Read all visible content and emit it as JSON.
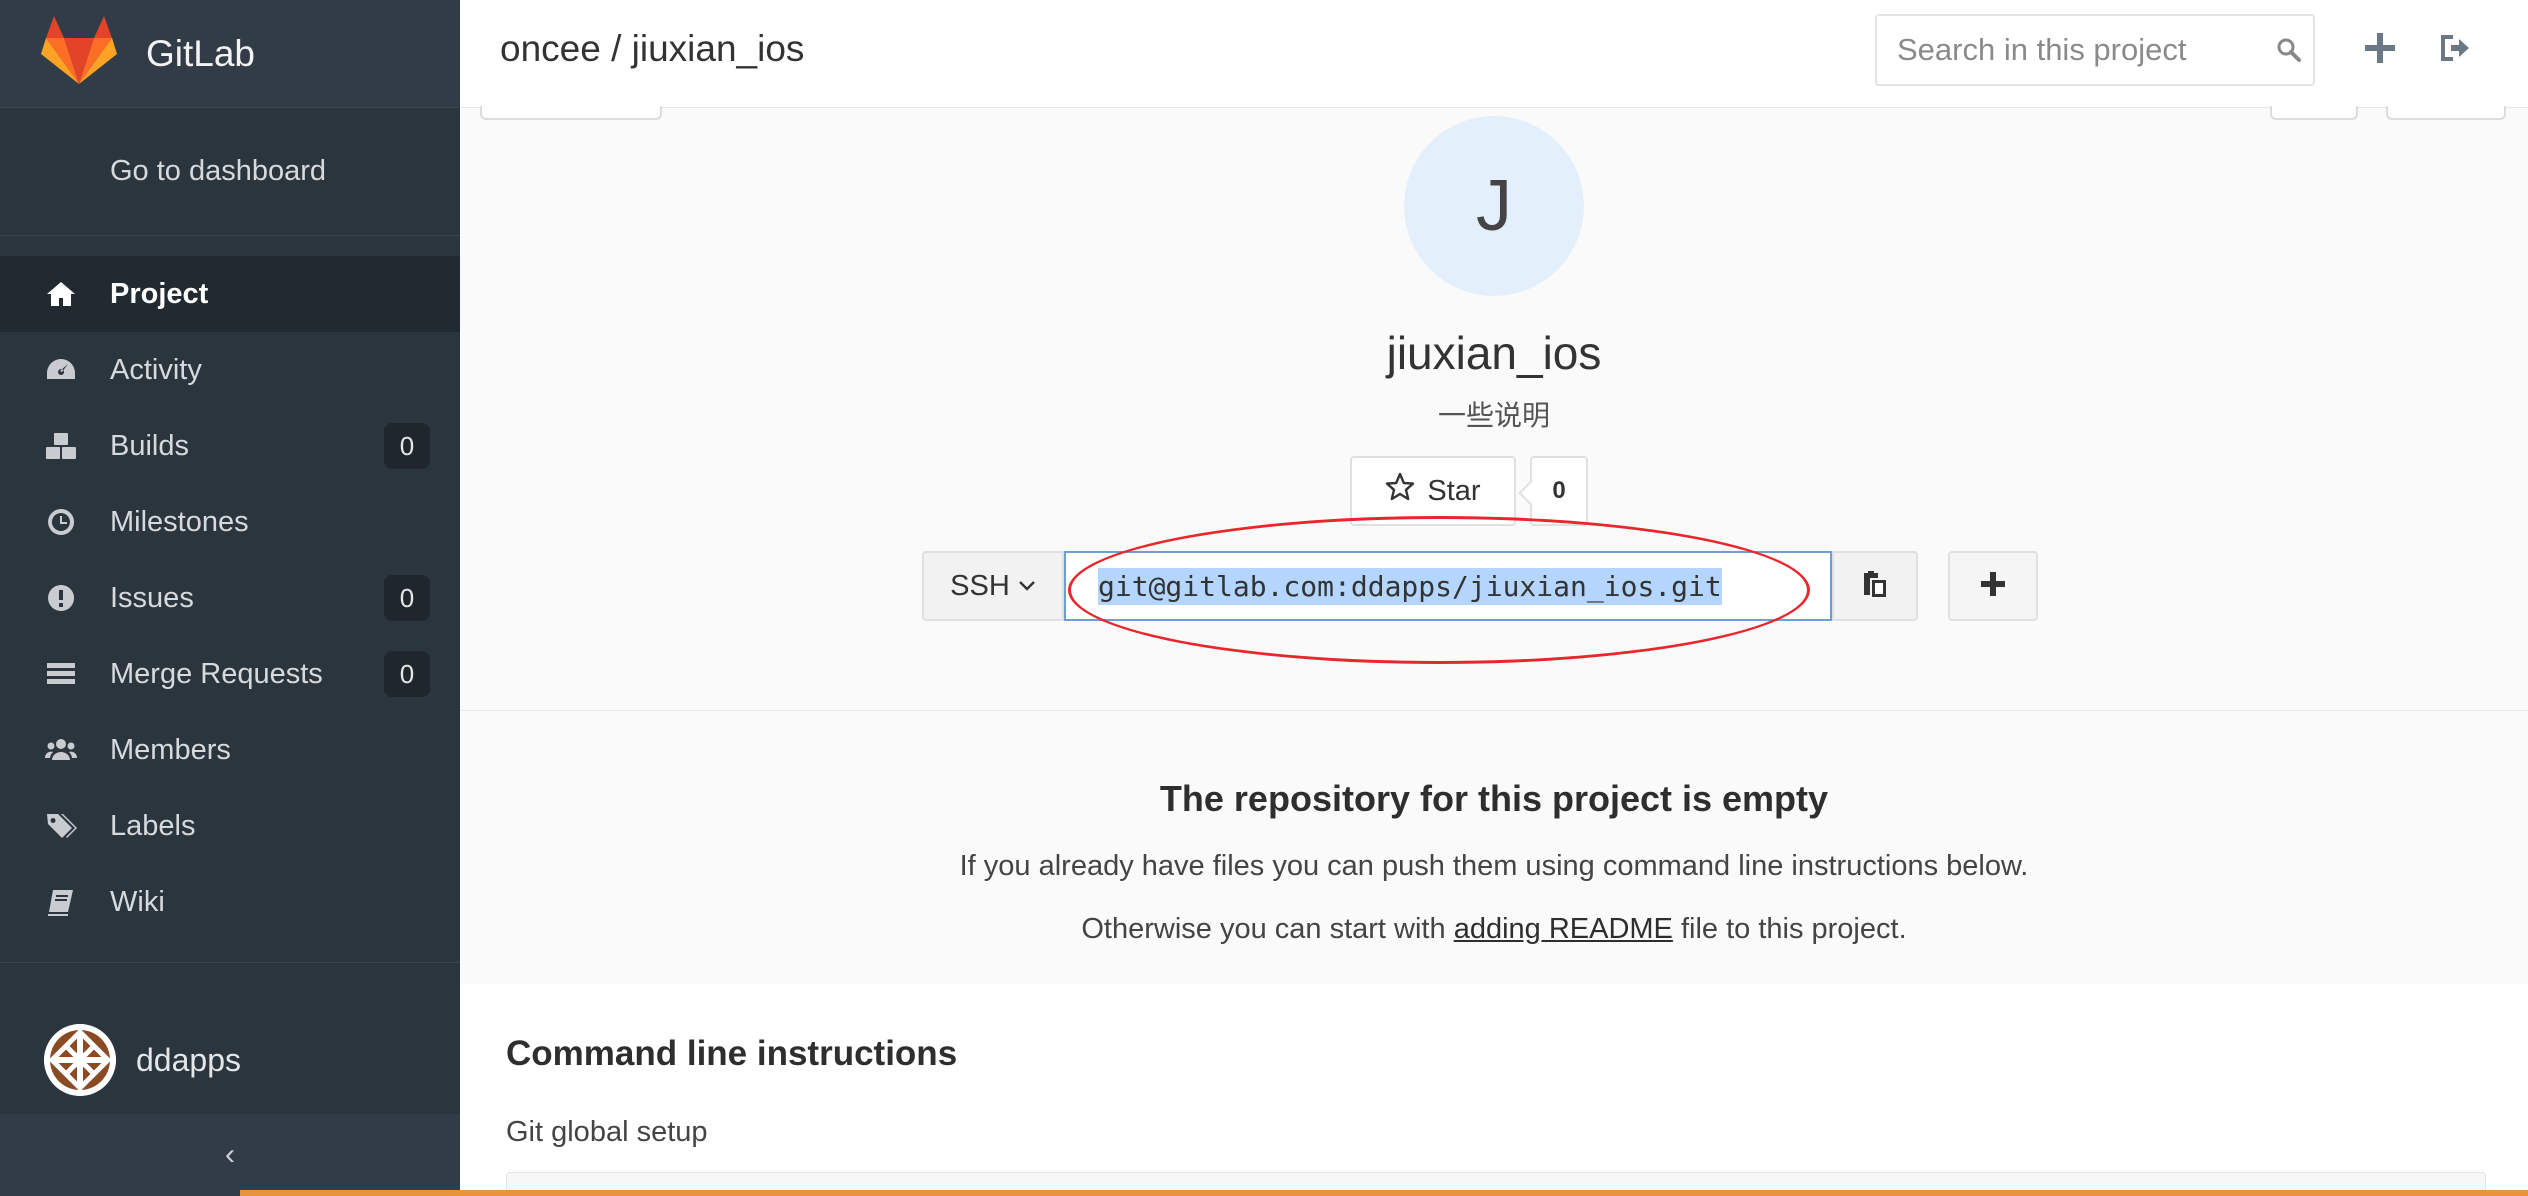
{
  "app": {
    "name": "GitLab",
    "brand_color": "#fc6d26"
  },
  "sidebar": {
    "dashboard_link": "Go to dashboard",
    "items": [
      {
        "label": "Project",
        "icon": "home-icon",
        "active": true
      },
      {
        "label": "Activity",
        "icon": "dashboard-icon"
      },
      {
        "label": "Builds",
        "icon": "cubes-icon",
        "count": "0"
      },
      {
        "label": "Milestones",
        "icon": "clock-icon"
      },
      {
        "label": "Issues",
        "icon": "exclamation-circle-icon",
        "count": "0"
      },
      {
        "label": "Merge Requests",
        "icon": "list-icon",
        "count": "0"
      },
      {
        "label": "Members",
        "icon": "users-icon"
      },
      {
        "label": "Labels",
        "icon": "tags-icon"
      },
      {
        "label": "Wiki",
        "icon": "book-icon"
      }
    ],
    "user": {
      "name": "ddapps"
    },
    "collapse_icon": "chevron-left-icon"
  },
  "header": {
    "breadcrumb": "oncee / jiuxian_ios",
    "search_placeholder": "Search in this project"
  },
  "project": {
    "avatar_letter": "J",
    "name": "jiuxian_ios",
    "description": "一些说明",
    "star_label": "Star",
    "star_count": "0",
    "protocol": "SSH",
    "clone_url": "git@gitlab.com:ddapps/jiuxian_ios.git"
  },
  "empty_repo": {
    "title": "The repository for this project is empty",
    "line1": "If you already have files you can push them using command line instructions below.",
    "line2_prefix": "Otherwise you can start with ",
    "line2_link": "adding README",
    "line2_suffix": " file to this project."
  },
  "cli": {
    "title": "Command line instructions",
    "section": "Git global setup"
  },
  "annotation": {
    "color": "#e8262c"
  }
}
